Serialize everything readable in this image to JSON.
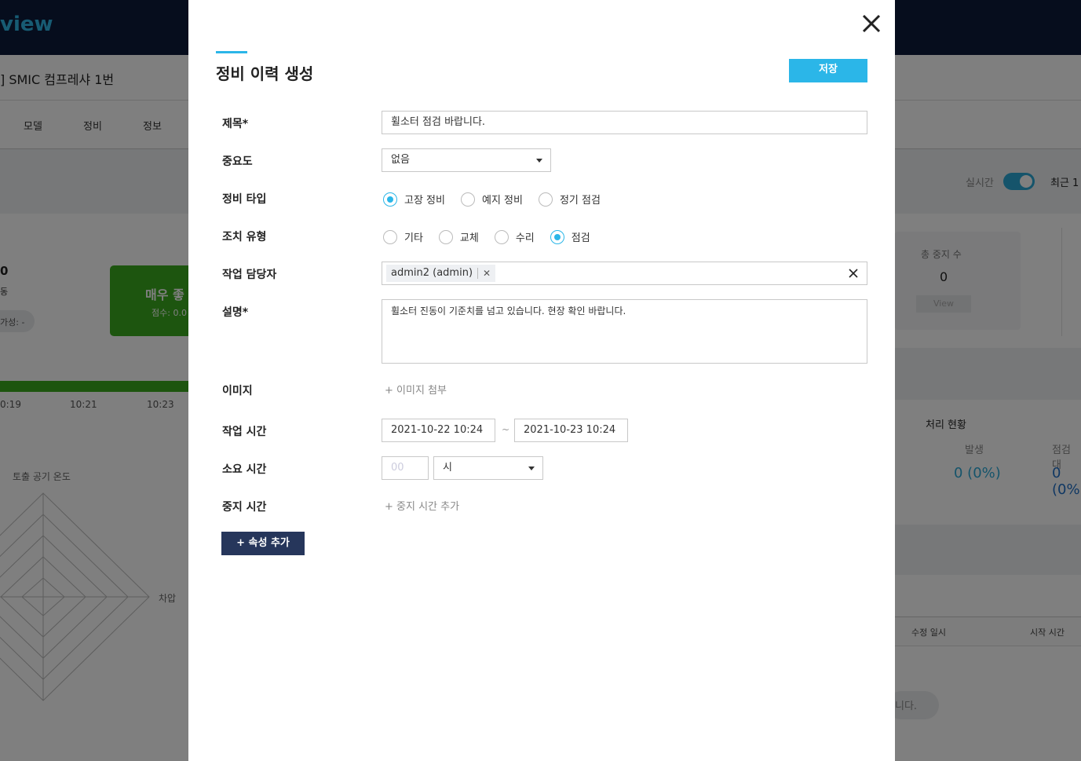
{
  "background": {
    "logo_text": "view",
    "asset_title": "] SMIC 컴프레샤 1번",
    "tabs": [
      "모델",
      "정비",
      "정보"
    ],
    "realtime_label": "실시간",
    "recent_label": "최근 1",
    "summary_value": "0",
    "summary_sub": "동",
    "pill_text": "가성: -",
    "status_card": {
      "title": "매우 좋",
      "score": "점수: 0.0"
    },
    "stop_card": {
      "label": "총 중지 수",
      "value": "0",
      "button": "View"
    },
    "times": [
      "0:19",
      "10:21",
      "10:23"
    ],
    "radar_labels": [
      "토출 공기 온도",
      "차압"
    ],
    "process_status": {
      "title": "처리 현황",
      "occur_label": "발생",
      "occur_value": "0 (0%)",
      "check_label": "점검 대",
      "check_value": "0 (0%"
    },
    "table_headers": [
      "수정 일시",
      "시작 시간"
    ],
    "empty_text": "니다."
  },
  "modal": {
    "title": "정비 이력 생성",
    "save_label": "저장",
    "fields": {
      "title_label": "제목*",
      "title_value": "휠소터 점검 바랍니다.",
      "priority_label": "중요도",
      "priority_value": "없음",
      "type_label": "정비 타입",
      "type_options": [
        "고장 정비",
        "예지 정비",
        "정기 점검"
      ],
      "type_selected": 0,
      "action_label": "조치 유형",
      "action_options": [
        "기타",
        "교체",
        "수리",
        "점검"
      ],
      "action_selected": 3,
      "assignee_label": "작업 담당자",
      "assignee_tag": "admin2 (admin)",
      "desc_label": "설명*",
      "desc_value": "휠소터 진동이 기준치를 넘고 있습니다. 현장 확인 바랍니다.",
      "image_label": "이미지",
      "image_link": "+ 이미지 첨부",
      "worktime_label": "작업 시간",
      "worktime_start": "2021-10-22 10:24",
      "worktime_sep": "~",
      "worktime_end": "2021-10-23 10:24",
      "duration_label": "소요 시간",
      "duration_placeholder": "00",
      "duration_unit": "시",
      "stoptime_label": "중지 시간",
      "stoptime_link": "+ 중지 시간 추가"
    },
    "add_attr_label": "+ 속성 추가"
  },
  "colors": {
    "accent": "#2bb6e8",
    "dark_button": "#26365b",
    "topbar": "#0d1a3a",
    "status_green": "#3aaa1e"
  }
}
